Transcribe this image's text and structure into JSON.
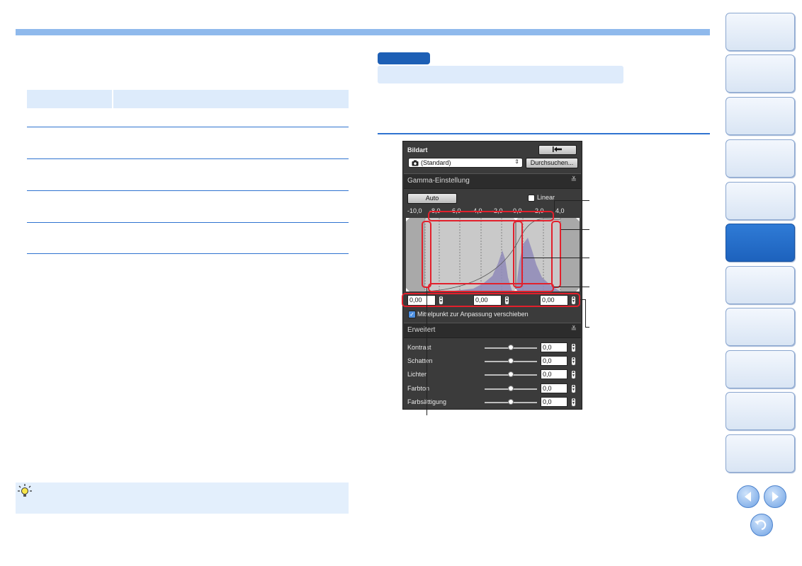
{
  "panel": {
    "bildart_label": "Bildart",
    "style_select": "(Standard)",
    "browse_button": "Durchsuchen...",
    "gamma_section": "Gamma-Einstellung",
    "auto_button": "Auto",
    "linear_label": "Linear",
    "scale_ticks": [
      "-10,0",
      "-8,0",
      "-6,0",
      "-4,0",
      "-2,0",
      "0,0",
      "2,0",
      "4,0"
    ],
    "value_fields": [
      "0,00",
      "0,00",
      "0,00"
    ],
    "midpoint_checkbox": "Mittelpunkt zur Anpassung verschieben",
    "advanced_section": "Erweitert",
    "sliders": [
      {
        "label": "Kontrast",
        "value": "0,0"
      },
      {
        "label": "Schatten",
        "value": "0,0"
      },
      {
        "label": "Lichter",
        "value": "0,0"
      },
      {
        "label": "Farbton",
        "value": "0,0"
      },
      {
        "label": "Farbsättigung",
        "value": "0,0"
      }
    ]
  },
  "colors": {
    "accent": "#2f73d0",
    "callout": "#e2202c",
    "active_tab": "#1d62bd"
  },
  "icons": [
    "tip-bulb-icon",
    "camera-icon",
    "reset-arrow-icon",
    "chevron-down-icon",
    "prev-page-icon",
    "next-page-icon",
    "return-icon"
  ]
}
